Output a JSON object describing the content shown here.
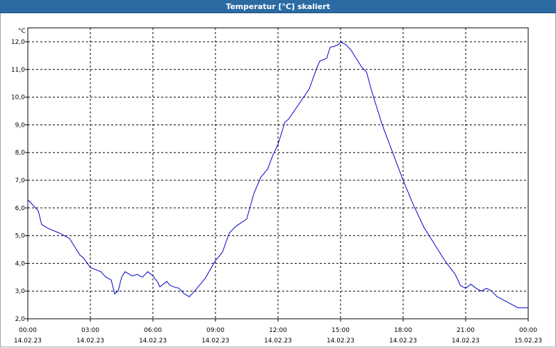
{
  "window": {
    "title": "Temperatur [°C] skaliert"
  },
  "colors": {
    "titlebar": "#2b6aa3",
    "line": "#0000c8",
    "grid": "#000000"
  },
  "chart_data": {
    "type": "line",
    "title": "Temperatur [°C] skaliert",
    "ylabel": "°C",
    "xlabel": "",
    "ylim": [
      2.0,
      12.0
    ],
    "xlim": [
      "2023-02-14 00:00",
      "2023-02-15 00:00"
    ],
    "grid": true,
    "y_ticks": [
      "2,0",
      "3,0",
      "4,0",
      "5,0",
      "6,0",
      "7,0",
      "8,0",
      "9,0",
      "10,0",
      "11,0",
      "12,0"
    ],
    "x_ticks": [
      {
        "time": "00:00",
        "date": "14.02.23"
      },
      {
        "time": "03:00",
        "date": "14.02.23"
      },
      {
        "time": "06:00",
        "date": "14.02.23"
      },
      {
        "time": "09:00",
        "date": "14.02.23"
      },
      {
        "time": "12:00",
        "date": "14.02.23"
      },
      {
        "time": "15:00",
        "date": "14.02.23"
      },
      {
        "time": "18:00",
        "date": "14.02.23"
      },
      {
        "time": "21:00",
        "date": "14.02.23"
      },
      {
        "time": "00:00",
        "date": "15.02.23"
      }
    ],
    "series": [
      {
        "x": [
          "2023-02-14 00:00",
          "2023-02-14 00:30",
          "2023-02-14 00:40",
          "2023-02-14 01:00",
          "2023-02-14 01:30",
          "2023-02-14 02:00",
          "2023-02-14 02:15",
          "2023-02-14 02:30",
          "2023-02-14 02:40",
          "2023-02-14 03:00",
          "2023-02-14 03:30",
          "2023-02-14 03:45",
          "2023-02-14 04:00",
          "2023-02-14 04:10",
          "2023-02-14 04:20",
          "2023-02-14 04:30",
          "2023-02-14 04:40",
          "2023-02-14 05:00",
          "2023-02-14 05:15",
          "2023-02-14 05:30",
          "2023-02-14 05:45",
          "2023-02-14 06:00",
          "2023-02-14 06:15",
          "2023-02-14 06:20",
          "2023-02-14 06:30",
          "2023-02-14 06:40",
          "2023-02-14 06:50",
          "2023-02-14 07:00",
          "2023-02-14 07:15",
          "2023-02-14 07:30",
          "2023-02-14 07:45",
          "2023-02-14 08:00",
          "2023-02-14 08:30",
          "2023-02-14 09:00",
          "2023-02-14 09:20",
          "2023-02-14 09:40",
          "2023-02-14 10:00",
          "2023-02-14 10:30",
          "2023-02-14 10:50",
          "2023-02-14 11:10",
          "2023-02-14 11:30",
          "2023-02-14 11:45",
          "2023-02-14 12:00",
          "2023-02-14 12:20",
          "2023-02-14 12:30",
          "2023-02-14 13:00",
          "2023-02-14 13:30",
          "2023-02-14 13:50",
          "2023-02-14 14:00",
          "2023-02-14 14:20",
          "2023-02-14 14:30",
          "2023-02-14 14:45",
          "2023-02-14 14:55",
          "2023-02-14 15:00",
          "2023-02-14 15:15",
          "2023-02-14 15:30",
          "2023-02-14 15:45",
          "2023-02-14 16:00",
          "2023-02-14 16:15",
          "2023-02-14 16:30",
          "2023-02-14 16:45",
          "2023-02-14 17:00",
          "2023-02-14 17:30",
          "2023-02-14 18:00",
          "2023-02-14 18:30",
          "2023-02-14 19:00",
          "2023-02-14 19:30",
          "2023-02-14 20:00",
          "2023-02-14 20:30",
          "2023-02-14 20:45",
          "2023-02-14 21:00",
          "2023-02-14 21:15",
          "2023-02-14 21:30",
          "2023-02-14 21:45",
          "2023-02-14 22:00",
          "2023-02-14 22:15",
          "2023-02-14 22:30",
          "2023-02-14 22:45",
          "2023-02-14 23:00",
          "2023-02-14 23:30",
          "2023-02-15 00:00"
        ],
        "values": [
          6.3,
          5.9,
          5.4,
          5.25,
          5.1,
          4.9,
          4.6,
          4.3,
          4.2,
          3.85,
          3.7,
          3.5,
          3.4,
          2.9,
          3.0,
          3.5,
          3.7,
          3.55,
          3.6,
          3.5,
          3.7,
          3.55,
          3.3,
          3.15,
          3.25,
          3.35,
          3.2,
          3.15,
          3.1,
          2.9,
          2.8,
          3.0,
          3.45,
          4.1,
          4.4,
          5.1,
          5.35,
          5.6,
          6.5,
          7.1,
          7.4,
          7.9,
          8.3,
          9.1,
          9.2,
          9.75,
          10.3,
          11.0,
          11.3,
          11.4,
          11.8,
          11.85,
          11.9,
          12.0,
          11.9,
          11.7,
          11.4,
          11.1,
          10.9,
          10.2,
          9.6,
          9.0,
          8.0,
          7.0,
          6.1,
          5.3,
          4.7,
          4.1,
          3.6,
          3.2,
          3.1,
          3.25,
          3.1,
          3.0,
          3.1,
          3.0,
          2.8,
          2.7,
          2.6,
          2.4,
          2.4
        ]
      }
    ]
  }
}
